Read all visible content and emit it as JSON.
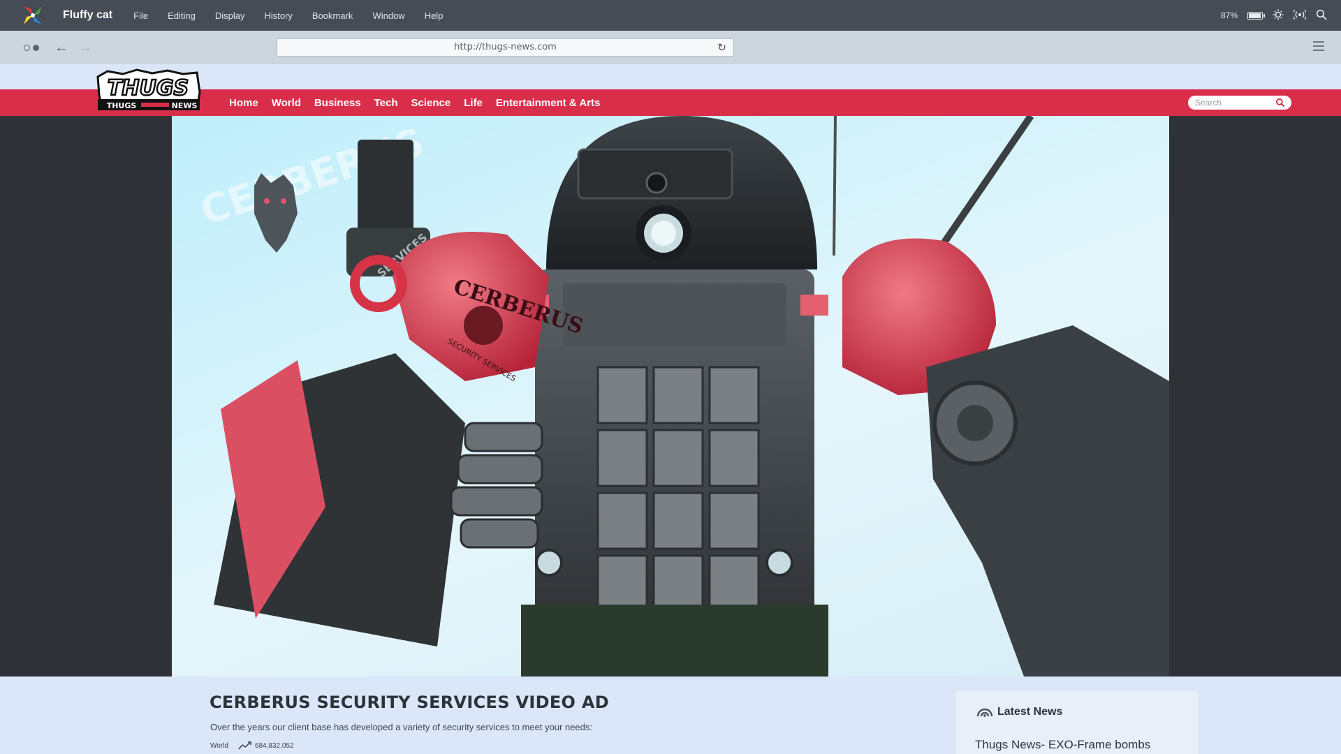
{
  "os_menubar": {
    "app_name": "Fluffy cat",
    "menus": [
      "File",
      "Editing",
      "Display",
      "History",
      "Bookmark",
      "Window",
      "Help"
    ],
    "battery_text": "87%",
    "battery_level": 0.87,
    "status_icons": [
      "battery-icon",
      "brightness-icon",
      "wifi-icon",
      "search-icon"
    ]
  },
  "browser": {
    "url": "http://thugs-news.com"
  },
  "site": {
    "logo_top": "THUGS",
    "logo_left": "THUGS",
    "logo_right": "NEWS",
    "nav": [
      "Home",
      "World",
      "Business",
      "Tech",
      "Science",
      "Life",
      "Entertainment & Arts"
    ],
    "search_placeholder": "Search",
    "brand_color": "#d92e4a"
  },
  "hero": {
    "badge_text": "CERBERUS",
    "side_text": "SERVICES",
    "shoulder_text": "CERBERUS",
    "shoulder_subtext": "SECURITY SERVICES"
  },
  "article": {
    "title": "CERBERUS SECURITY SERVICES VIDEO AD",
    "summary": "Over the years our client base has developed a variety of security services to meet your needs:",
    "category": "World",
    "views": "684,832,052"
  },
  "latest": {
    "heading": "Latest News",
    "items": [
      "Thugs News- EXO-Frame bombs"
    ]
  }
}
